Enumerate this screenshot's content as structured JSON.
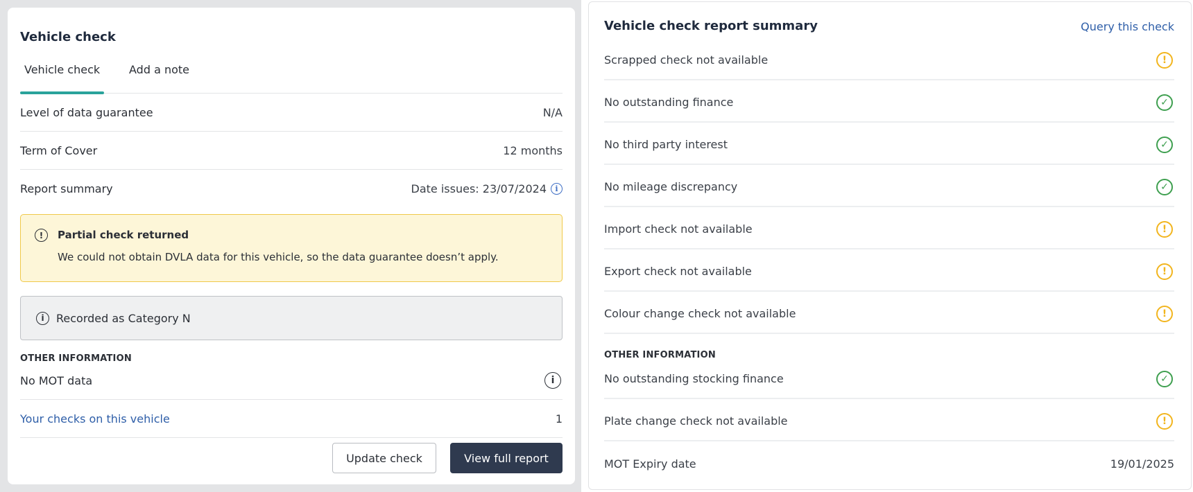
{
  "left_panel": {
    "title": "Vehicle check",
    "tabs": [
      {
        "label": "Vehicle check",
        "active": true
      },
      {
        "label": "Add a note",
        "active": false
      }
    ],
    "rows": [
      {
        "label": "Level of data guarantee",
        "value": "N/A"
      },
      {
        "label": "Term of Cover",
        "value": "12 months"
      },
      {
        "label": "Report summary",
        "value": "Date issues: 23/07/2024"
      }
    ],
    "warning_alert": {
      "title": "Partial check returned",
      "message": "We could not obtain DVLA data for this vehicle, so the data guarantee doesn’t apply."
    },
    "info_alert": {
      "message": "Recorded as Category N"
    },
    "other_info_label": "OTHER INFORMATION",
    "other_rows": [
      {
        "label": "No MOT data"
      },
      {
        "label": "Your checks on this vehicle",
        "value": "1"
      }
    ],
    "buttons": {
      "update": "Update check",
      "view_full": "View full report"
    }
  },
  "right_panel": {
    "title": "Vehicle check report summary",
    "query_link": "Query this check",
    "items": [
      {
        "label": "Scrapped check not available",
        "status": "warning"
      },
      {
        "label": "No outstanding finance",
        "status": "ok"
      },
      {
        "label": "No third party interest",
        "status": "ok"
      },
      {
        "label": "No mileage discrepancy",
        "status": "ok"
      },
      {
        "label": "Import check not available",
        "status": "warning"
      },
      {
        "label": "Export check not available",
        "status": "warning"
      },
      {
        "label": "Colour change check not available",
        "status": "warning"
      }
    ],
    "other_info_label": "OTHER INFORMATION",
    "other_items": [
      {
        "label": "No outstanding stocking finance",
        "status": "ok"
      },
      {
        "label": "Plate change check not available",
        "status": "warning"
      },
      {
        "label": "MOT Expiry date",
        "value": "19/01/2025"
      }
    ]
  },
  "colors": {
    "accent_tab": "#2aa39b",
    "link": "#2e5ea8",
    "primary_button": "#2f3a4f",
    "warning": "#f2b51e",
    "ok": "#3e9f4f",
    "alert_bg": "#fdf6d8"
  },
  "icons": {
    "warning_alert": "exclamation-circle-icon",
    "info": "info-circle-icon",
    "status_warning": "warning-circle-icon",
    "status_ok": "check-circle-icon"
  }
}
